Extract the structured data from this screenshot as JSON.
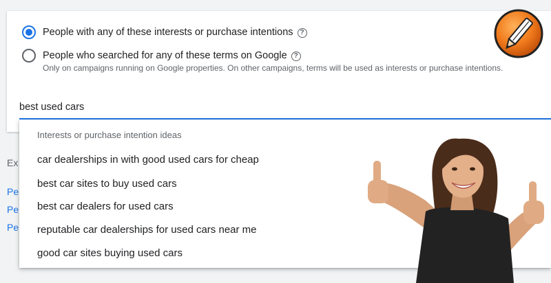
{
  "audience": {
    "option_interests": {
      "label": "People with any of these interests or purchase intentions",
      "selected": true,
      "help_icon": "help-circle-icon"
    },
    "option_searched": {
      "label": "People who searched for any of these terms on Google",
      "sublabel": "Only on campaigns running on Google properties. On other campaigns, terms will be used as interests or purchase intentions.",
      "selected": false,
      "help_icon": "help-circle-icon"
    },
    "search_value": "best used cars"
  },
  "background": {
    "partial_label": "Ex",
    "partial_links": [
      "Pe",
      "Pe",
      "Pe"
    ]
  },
  "suggestions": {
    "header": "Interests or purchase intention ideas",
    "items": [
      "car dealerships in with good used cars for cheap",
      "best car sites to buy used cars",
      "best car dealers for used cars",
      "reputable car dealerships for used cars near me",
      "good car sites buying used cars"
    ]
  },
  "colors": {
    "accent": "#1a73e8",
    "text": "#202124",
    "secondary_text": "#5f6368",
    "logo_orange": "#f07a1c"
  }
}
